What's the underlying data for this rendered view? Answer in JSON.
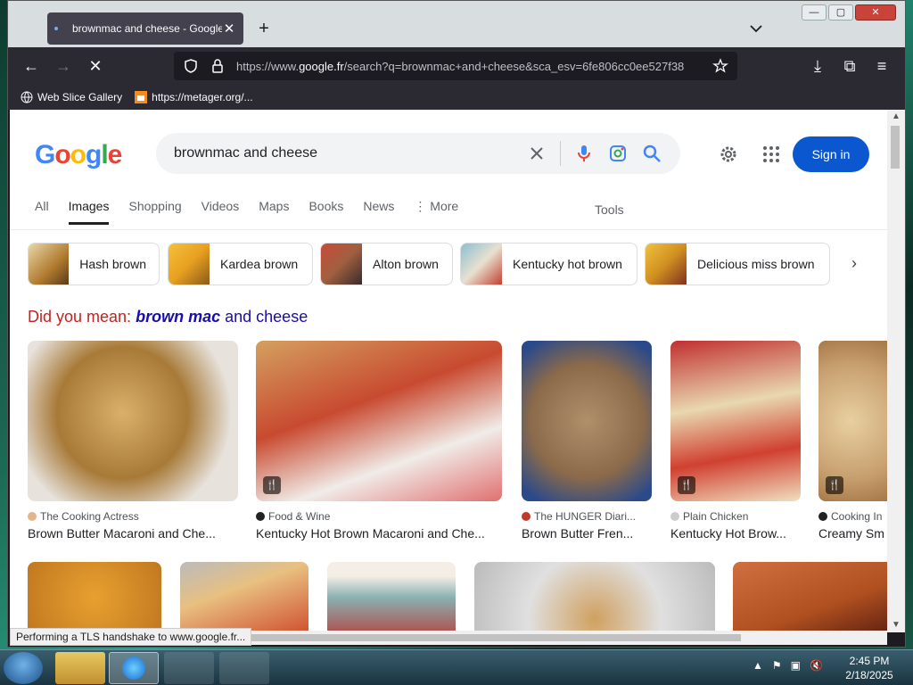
{
  "browser": {
    "tab_title": "brownmac and cheese - Google",
    "new_tab": "+",
    "url_prefix": "https://www.",
    "url_domain": "google.fr",
    "url_rest": "/search?q=brownmac+and+cheese&sca_esv=6fe806cc0ee527f38",
    "bookmarks": [
      "Web Slice Gallery",
      "https://metager.org/..."
    ],
    "status": "Performing a TLS handshake to www.google.fr..."
  },
  "google": {
    "logo": [
      "G",
      "o",
      "o",
      "g",
      "l",
      "e"
    ],
    "query": "brownmac and cheese",
    "signin": "Sign in",
    "tabs": [
      "All",
      "Images",
      "Shopping",
      "Videos",
      "Maps",
      "Books",
      "News",
      "More"
    ],
    "tools": "Tools",
    "chips": [
      "Hash brown",
      "Kardea brown",
      "Alton brown",
      "Kentucky hot brown",
      "Delicious miss brown"
    ],
    "did_you_mean_label": "Did you mean:",
    "did_you_mean_bold": "brown mac",
    "did_you_mean_rest": "and cheese",
    "results": [
      {
        "source": "The Cooking Actress",
        "title": "Brown Butter Macaroni and Che..."
      },
      {
        "source": "Food & Wine",
        "title": "Kentucky Hot Brown Macaroni and Che..."
      },
      {
        "source": "The HUNGER Diari...",
        "title": "Brown Butter Fren..."
      },
      {
        "source": "Plain Chicken",
        "title": "Kentucky Hot Brow..."
      },
      {
        "source": "Cooking In",
        "title": "Creamy Sm"
      }
    ]
  },
  "taskbar": {
    "time": "2:45 PM",
    "date": "2/18/2025"
  },
  "colors": {
    "accent": "#0b57d0",
    "did_you_mean": "#c5221f",
    "link": "#1a0dab"
  }
}
